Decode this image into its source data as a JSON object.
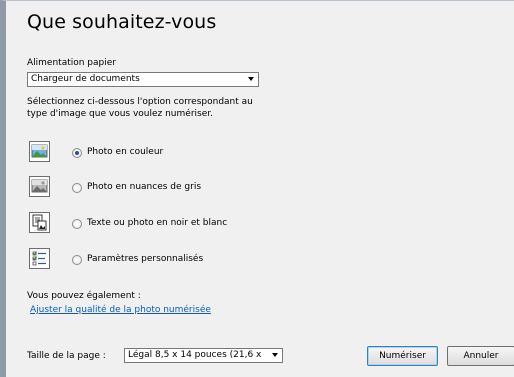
{
  "dialog": {
    "title": "Que souhaitez-vous"
  },
  "source": {
    "label": "Alimentation papier",
    "selected": "Chargeur de documents"
  },
  "instruction": {
    "line1": "Sélectionnez ci-dessous l'option correspondant au",
    "line2": "type d'image que vous voulez numériser."
  },
  "options": [
    {
      "label": "Photo en couleur",
      "icon": "color-photo-icon",
      "selected": true
    },
    {
      "label": "Photo en nuances de gris",
      "icon": "grayscale-photo-icon",
      "selected": false
    },
    {
      "label": "Texte ou photo en noir et blanc",
      "icon": "black-white-text-icon",
      "selected": false
    },
    {
      "label": "Paramètres personnalisés",
      "icon": "custom-settings-icon",
      "selected": false
    }
  ],
  "also": {
    "label": "Vous pouvez également :",
    "link": "Ajuster la qualité de la photo numérisée"
  },
  "page_size": {
    "label": "Taille de la page :",
    "selected": "Légal 8,5 x 14 pouces (21,6 x"
  },
  "buttons": {
    "scan": "Numériser",
    "cancel": "Annuler"
  },
  "colors": {
    "link": "#0a5db8",
    "window_border": "#8f9aa6",
    "background": "#f0f0f0"
  }
}
